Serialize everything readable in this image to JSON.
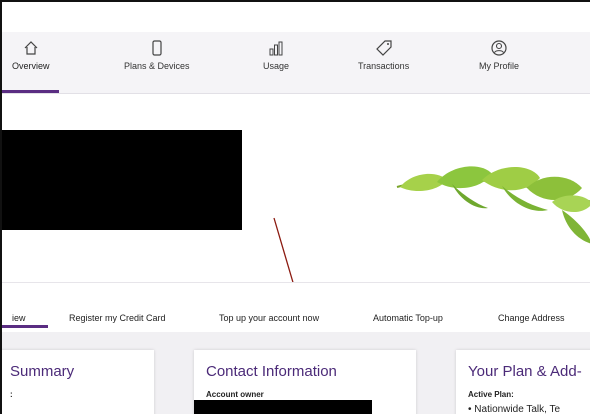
{
  "nav": {
    "items": [
      {
        "label": "Overview",
        "icon": "home-icon"
      },
      {
        "label": "Plans & Devices",
        "icon": "phone-icon"
      },
      {
        "label": "Usage",
        "icon": "bar-chart-icon"
      },
      {
        "label": "Transactions",
        "icon": "tag-icon"
      },
      {
        "label": "My Profile",
        "icon": "profile-icon"
      }
    ]
  },
  "subnav": {
    "items": [
      {
        "label": "iew"
      },
      {
        "label": "Register my Credit Card"
      },
      {
        "label": "Top up your account now"
      },
      {
        "label": "Automatic Top-up"
      },
      {
        "label": "Change Address"
      }
    ]
  },
  "cards": {
    "summary": {
      "title": "Summary",
      "sub": ":"
    },
    "contact": {
      "title": "Contact Information",
      "sub": "Account owner"
    },
    "plan": {
      "title": "Your Plan & Add-",
      "sub": "Active Plan:",
      "line": "• Nationwide Talk, Te"
    }
  },
  "colors": {
    "accent": "#5a2d82",
    "title": "#4b2a78",
    "arrow": "#8b1a10"
  }
}
